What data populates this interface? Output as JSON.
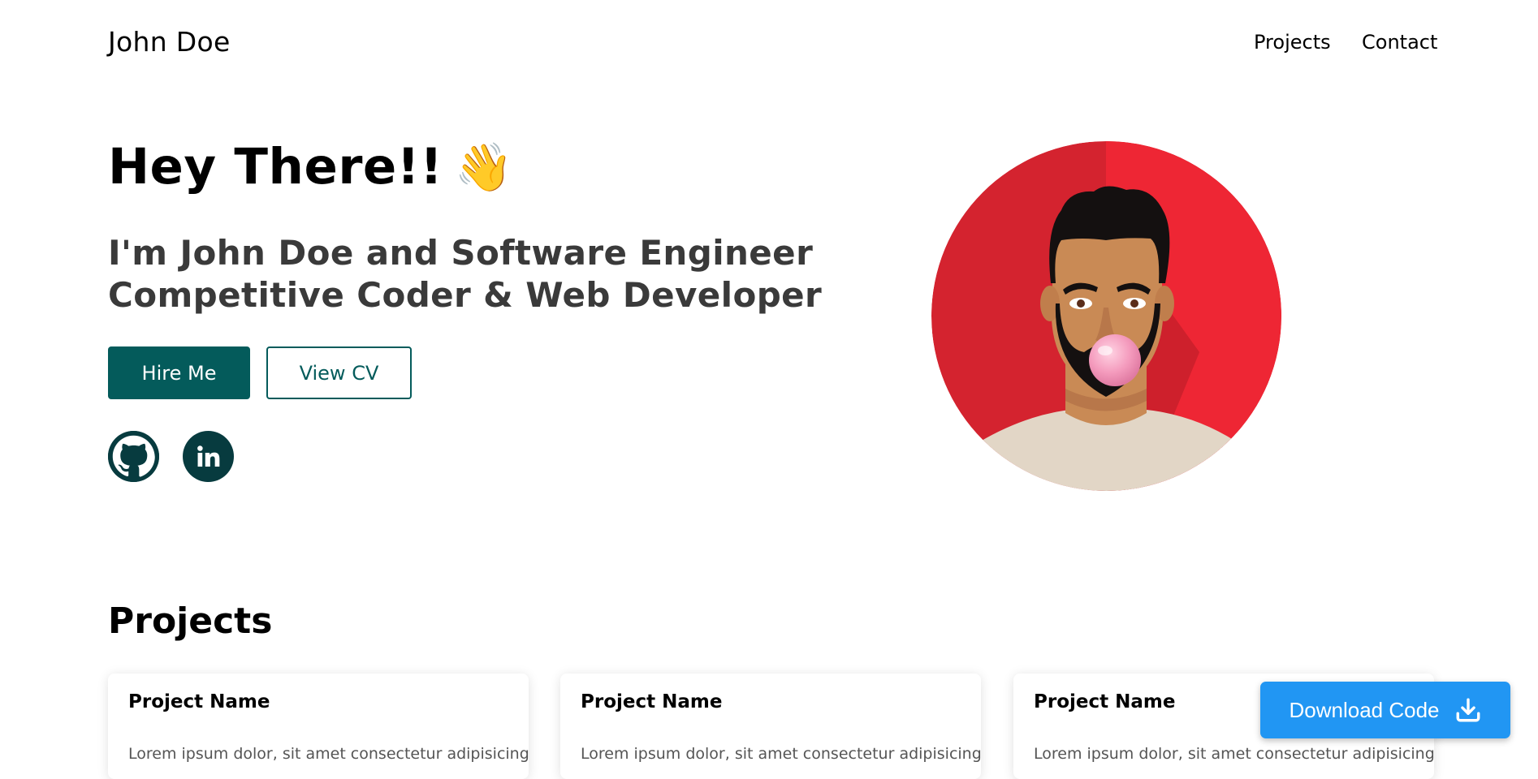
{
  "header": {
    "brand": "John Doe",
    "nav": [
      {
        "label": "Projects"
      },
      {
        "label": "Contact"
      }
    ]
  },
  "hero": {
    "greeting": "Hey There!!",
    "greeting_emoji": "👋",
    "subtitle_lines": [
      "I'm John Doe and Software Engineer",
      "Competitive Coder & Web Developer"
    ],
    "buttons": {
      "hire": "Hire Me",
      "cv": "View CV"
    },
    "social": [
      {
        "icon": "github-icon"
      },
      {
        "icon": "linkedin-icon"
      }
    ],
    "avatar_icon": "avatar-illustration"
  },
  "projects": {
    "title": "Projects",
    "cards": [
      {
        "title": "Project Name",
        "text": "Lorem ipsum dolor, sit amet consectetur adipisicing"
      },
      {
        "title": "Project Name",
        "text": "Lorem ipsum dolor, sit amet consectetur adipisicing"
      },
      {
        "title": "Project Name",
        "text": "Lorem ipsum dolor, sit amet consectetur adipisicing"
      }
    ]
  },
  "download": {
    "label": "Download Code",
    "icon": "download-icon"
  },
  "colors": {
    "primary": "#045b5b",
    "social_bg": "#073b3f",
    "download_bg": "#2196f3",
    "avatar_bg": "#e5252f"
  }
}
